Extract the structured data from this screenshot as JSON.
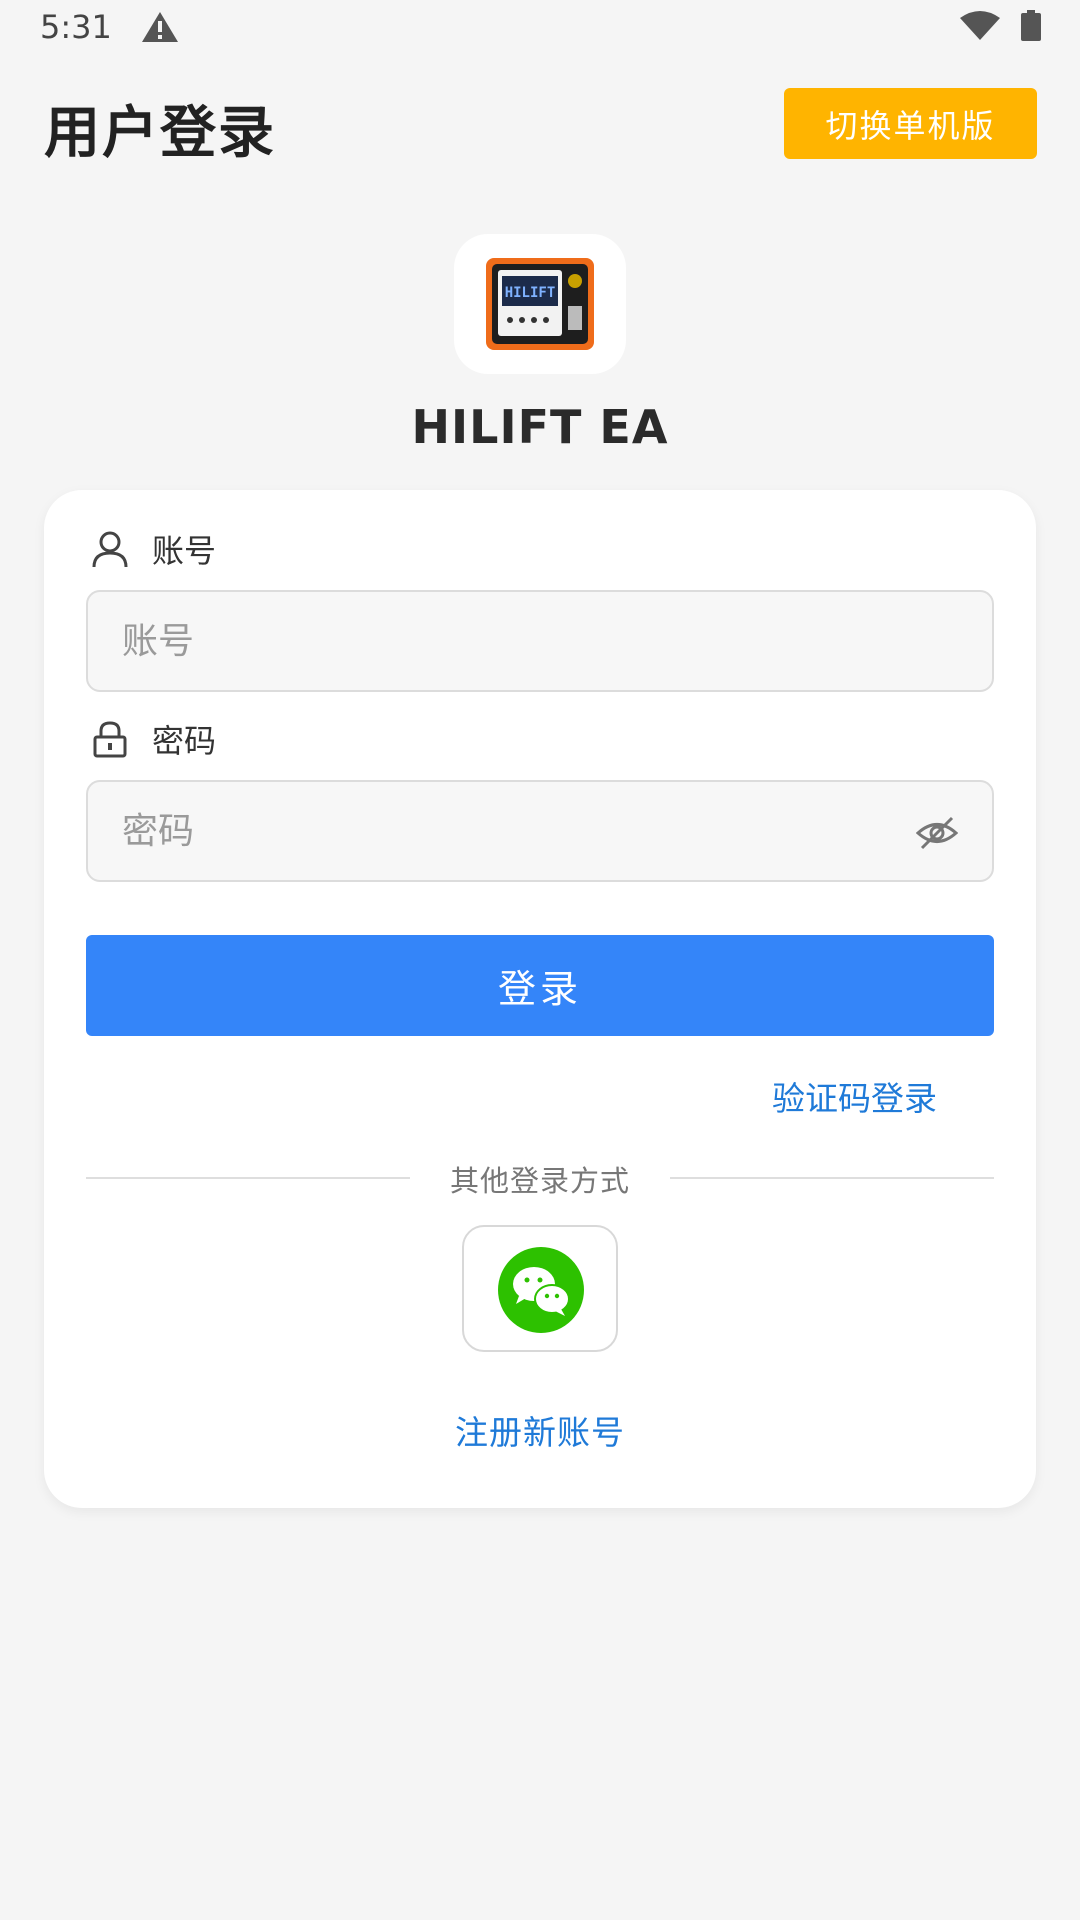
{
  "status_bar": {
    "time": "5:31"
  },
  "header": {
    "title": "用户登录",
    "switch_button": "切换单机版"
  },
  "logo": {
    "app_name": "HILIFT EA",
    "logo_text": "HILIFT"
  },
  "form": {
    "account_label": "账号",
    "account_placeholder": "账号",
    "password_label": "密码",
    "password_placeholder": "密码",
    "login_button": "登录",
    "sms_login": "验证码登录"
  },
  "other": {
    "divider_text": "其他登录方式",
    "register_link": "注册新账号"
  },
  "colors": {
    "accent": "#3485f9",
    "switch_button": "#ffb400",
    "link": "#1f7ad8",
    "wechat": "#2dc100",
    "background": "#f5f5f5"
  },
  "icons": [
    "warning-icon",
    "wifi-icon",
    "battery-icon",
    "user-icon",
    "lock-icon",
    "eye-off-icon",
    "wechat-icon"
  ]
}
